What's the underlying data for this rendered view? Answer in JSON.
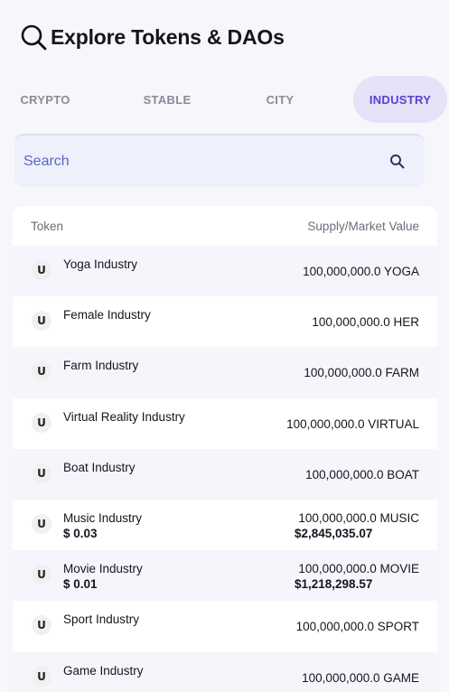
{
  "header": {
    "title": "Explore Tokens & DAOs",
    "icon": "search-icon"
  },
  "tabs": [
    {
      "label": "CRYPTO",
      "active": false
    },
    {
      "label": "STABLE",
      "active": false
    },
    {
      "label": "CITY",
      "active": false
    },
    {
      "label": "INDUSTRY",
      "active": true
    }
  ],
  "search": {
    "placeholder": "Search",
    "value": ""
  },
  "table": {
    "headers": {
      "token": "Token",
      "supply": "Supply/Market Value"
    },
    "rows": [
      {
        "name": "Yoga Industry",
        "price": "",
        "supply": "100,000,000.0 YOGA",
        "market_value": ""
      },
      {
        "name": "Female Industry",
        "price": "",
        "supply": "100,000,000.0 HER",
        "market_value": ""
      },
      {
        "name": "Farm Industry",
        "price": "",
        "supply": "100,000,000.0 FARM",
        "market_value": ""
      },
      {
        "name": "Virtual Reality Industry",
        "price": "",
        "supply": "100,000,000.0 VIRTUAL",
        "market_value": ""
      },
      {
        "name": "Boat Industry",
        "price": "",
        "supply": "100,000,000.0 BOAT",
        "market_value": ""
      },
      {
        "name": "Music Industry",
        "price": "$ 0.03",
        "supply": "100,000,000.0 MUSIC",
        "market_value": "$2,845,035.07"
      },
      {
        "name": "Movie Industry",
        "price": "$ 0.01",
        "supply": "100,000,000.0 MOVIE",
        "market_value": "$1,218,298.57"
      },
      {
        "name": "Sport Industry",
        "price": "",
        "supply": "100,000,000.0 SPORT",
        "market_value": ""
      },
      {
        "name": "Game Industry",
        "price": "",
        "supply": "100,000,000.0 GAME",
        "market_value": ""
      }
    ]
  },
  "colors": {
    "accent": "#5b3fd4",
    "active_tab_bg": "#e6e2f7",
    "search_bg": "#eef0fb",
    "row_alt": "#f5f5fc"
  }
}
